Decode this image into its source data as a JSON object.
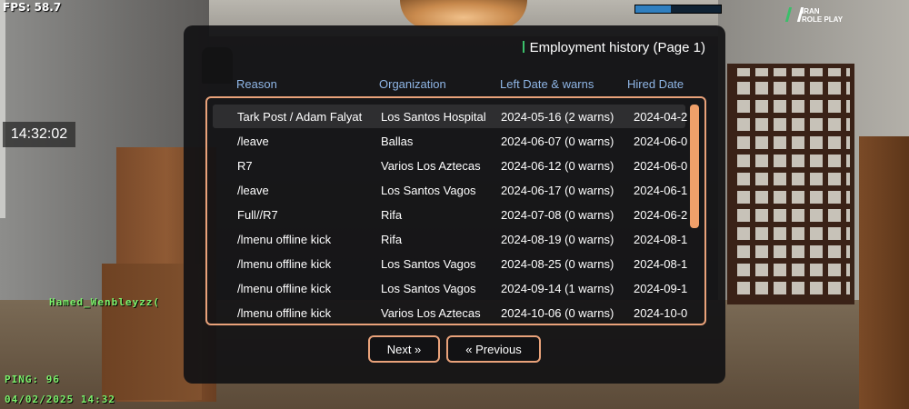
{
  "hud": {
    "fps": "FPS: 58.7",
    "clock": "14:32:02",
    "player_name": "Hamed_Wenbleyzz(",
    "ping": "PING: 96",
    "datetime": "04/02/2025 14:32",
    "health_fraction": 0.42,
    "logo": {
      "line1": "IRAN",
      "line2": "ROLE PLAY"
    }
  },
  "dialog": {
    "title": "Employment history (Page 1)",
    "columns": {
      "reason": "Reason",
      "organization": "Organization",
      "left_date": "Left Date & warns",
      "hired_date": "Hired Date"
    },
    "rows": [
      {
        "reason": "Tark Post / Adam Falyat",
        "organization": "Los Santos Hospital",
        "left_date": "2024-05-16 (2 warns)",
        "hired_date": "2024-04-2"
      },
      {
        "reason": "/leave",
        "organization": "Ballas",
        "left_date": "2024-06-07 (0 warns)",
        "hired_date": "2024-06-0"
      },
      {
        "reason": "R7",
        "organization": "Varios Los Aztecas",
        "left_date": "2024-06-12 (0 warns)",
        "hired_date": "2024-06-0"
      },
      {
        "reason": "/leave",
        "organization": "Los Santos Vagos",
        "left_date": "2024-06-17 (0 warns)",
        "hired_date": "2024-06-1"
      },
      {
        "reason": "Full//R7",
        "organization": "Rifa",
        "left_date": "2024-07-08 (0 warns)",
        "hired_date": "2024-06-2"
      },
      {
        "reason": "/lmenu offline kick",
        "organization": "Rifa",
        "left_date": "2024-08-19 (0 warns)",
        "hired_date": "2024-08-1"
      },
      {
        "reason": "/lmenu offline kick",
        "organization": "Los Santos Vagos",
        "left_date": "2024-08-25 (0 warns)",
        "hired_date": "2024-08-1"
      },
      {
        "reason": "/lmenu offline kick",
        "organization": "Los Santos Vagos",
        "left_date": "2024-09-14 (1 warns)",
        "hired_date": "2024-09-1"
      },
      {
        "reason": "/lmenu offline kick",
        "organization": "Varios Los Aztecas",
        "left_date": "2024-10-06 (0 warns)",
        "hired_date": "2024-10-0"
      }
    ],
    "next_label": "Next »",
    "prev_label": "« Previous",
    "accent_color": "#e9a27a"
  }
}
